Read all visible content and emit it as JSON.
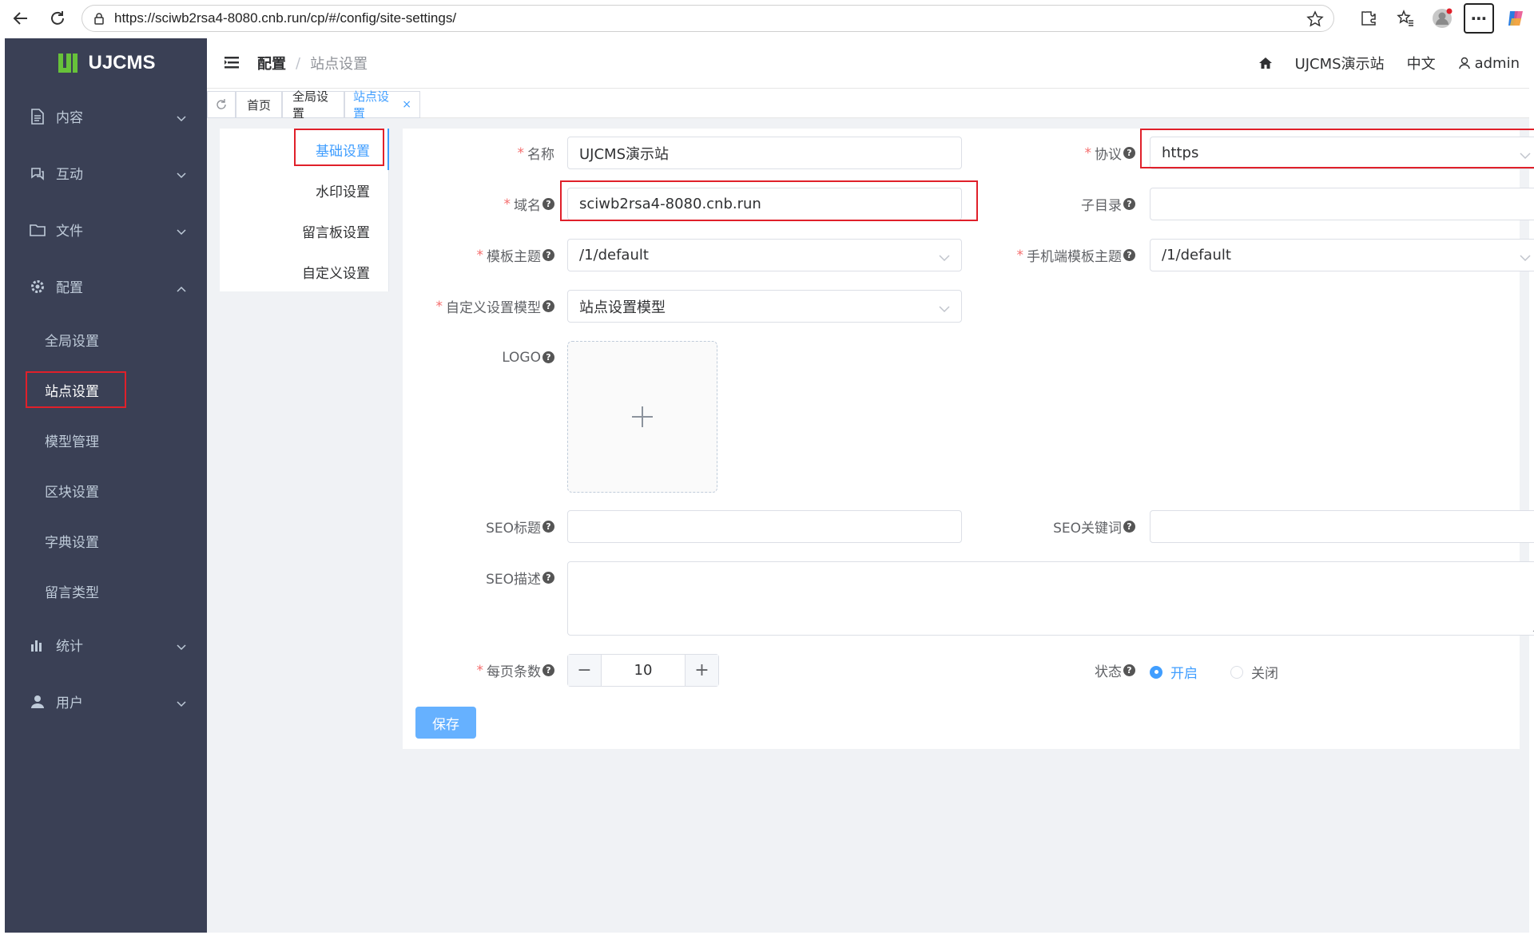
{
  "browser": {
    "url": "https://sciwb2rsa4-8080.cnb.run/cp/#/config/site-settings/"
  },
  "app": {
    "logo_text": "UJCMS",
    "brand_color": "#67c23a"
  },
  "sidebar": {
    "menus": [
      {
        "label": "内容",
        "icon": "document-icon"
      },
      {
        "label": "互动",
        "icon": "chat-icon"
      },
      {
        "label": "文件",
        "icon": "folder-icon"
      },
      {
        "label": "配置",
        "icon": "gear-icon"
      },
      {
        "label": "统计",
        "icon": "bar-chart-icon"
      },
      {
        "label": "用户",
        "icon": "user-icon"
      }
    ],
    "config_items": [
      "全局设置",
      "站点设置",
      "模型管理",
      "区块设置",
      "字典设置",
      "留言类型"
    ]
  },
  "header": {
    "breadcrumb_parent": "配置",
    "breadcrumb_separator": "/",
    "breadcrumb_current": "站点设置",
    "site_name": "UJCMS演示站",
    "language": "中文",
    "username": "admin"
  },
  "tabs": [
    {
      "label": "首页"
    },
    {
      "label": "全局设置"
    },
    {
      "label": "站点设置",
      "close": "×"
    }
  ],
  "subnav": [
    "基础设置",
    "水印设置",
    "留言板设置",
    "自定义设置"
  ],
  "form": {
    "name_label": "名称",
    "name_value": "UJCMS演示站",
    "protocol_label": "协议",
    "protocol_value": "https",
    "domain_label": "域名",
    "domain_value": "sciwb2rsa4-8080.cnb.run",
    "subdir_label": "子目录",
    "subdir_value": "",
    "theme_label": "模板主题",
    "theme_value": "/1/default",
    "mobile_theme_label": "手机端模板主题",
    "mobile_theme_value": "/1/default",
    "custom_model_label": "自定义设置模型",
    "custom_model_value": "站点设置模型",
    "logo_label": "LOGO",
    "seo_title_label": "SEO标题",
    "seo_keywords_label": "SEO关键词",
    "seo_desc_label": "SEO描述",
    "page_size_label": "每页条数",
    "page_size_value": "10",
    "status_label": "状态",
    "status_on": "开启",
    "status_off": "关闭",
    "save_label": "保存",
    "required_mark": "*",
    "help_mark": "?"
  }
}
